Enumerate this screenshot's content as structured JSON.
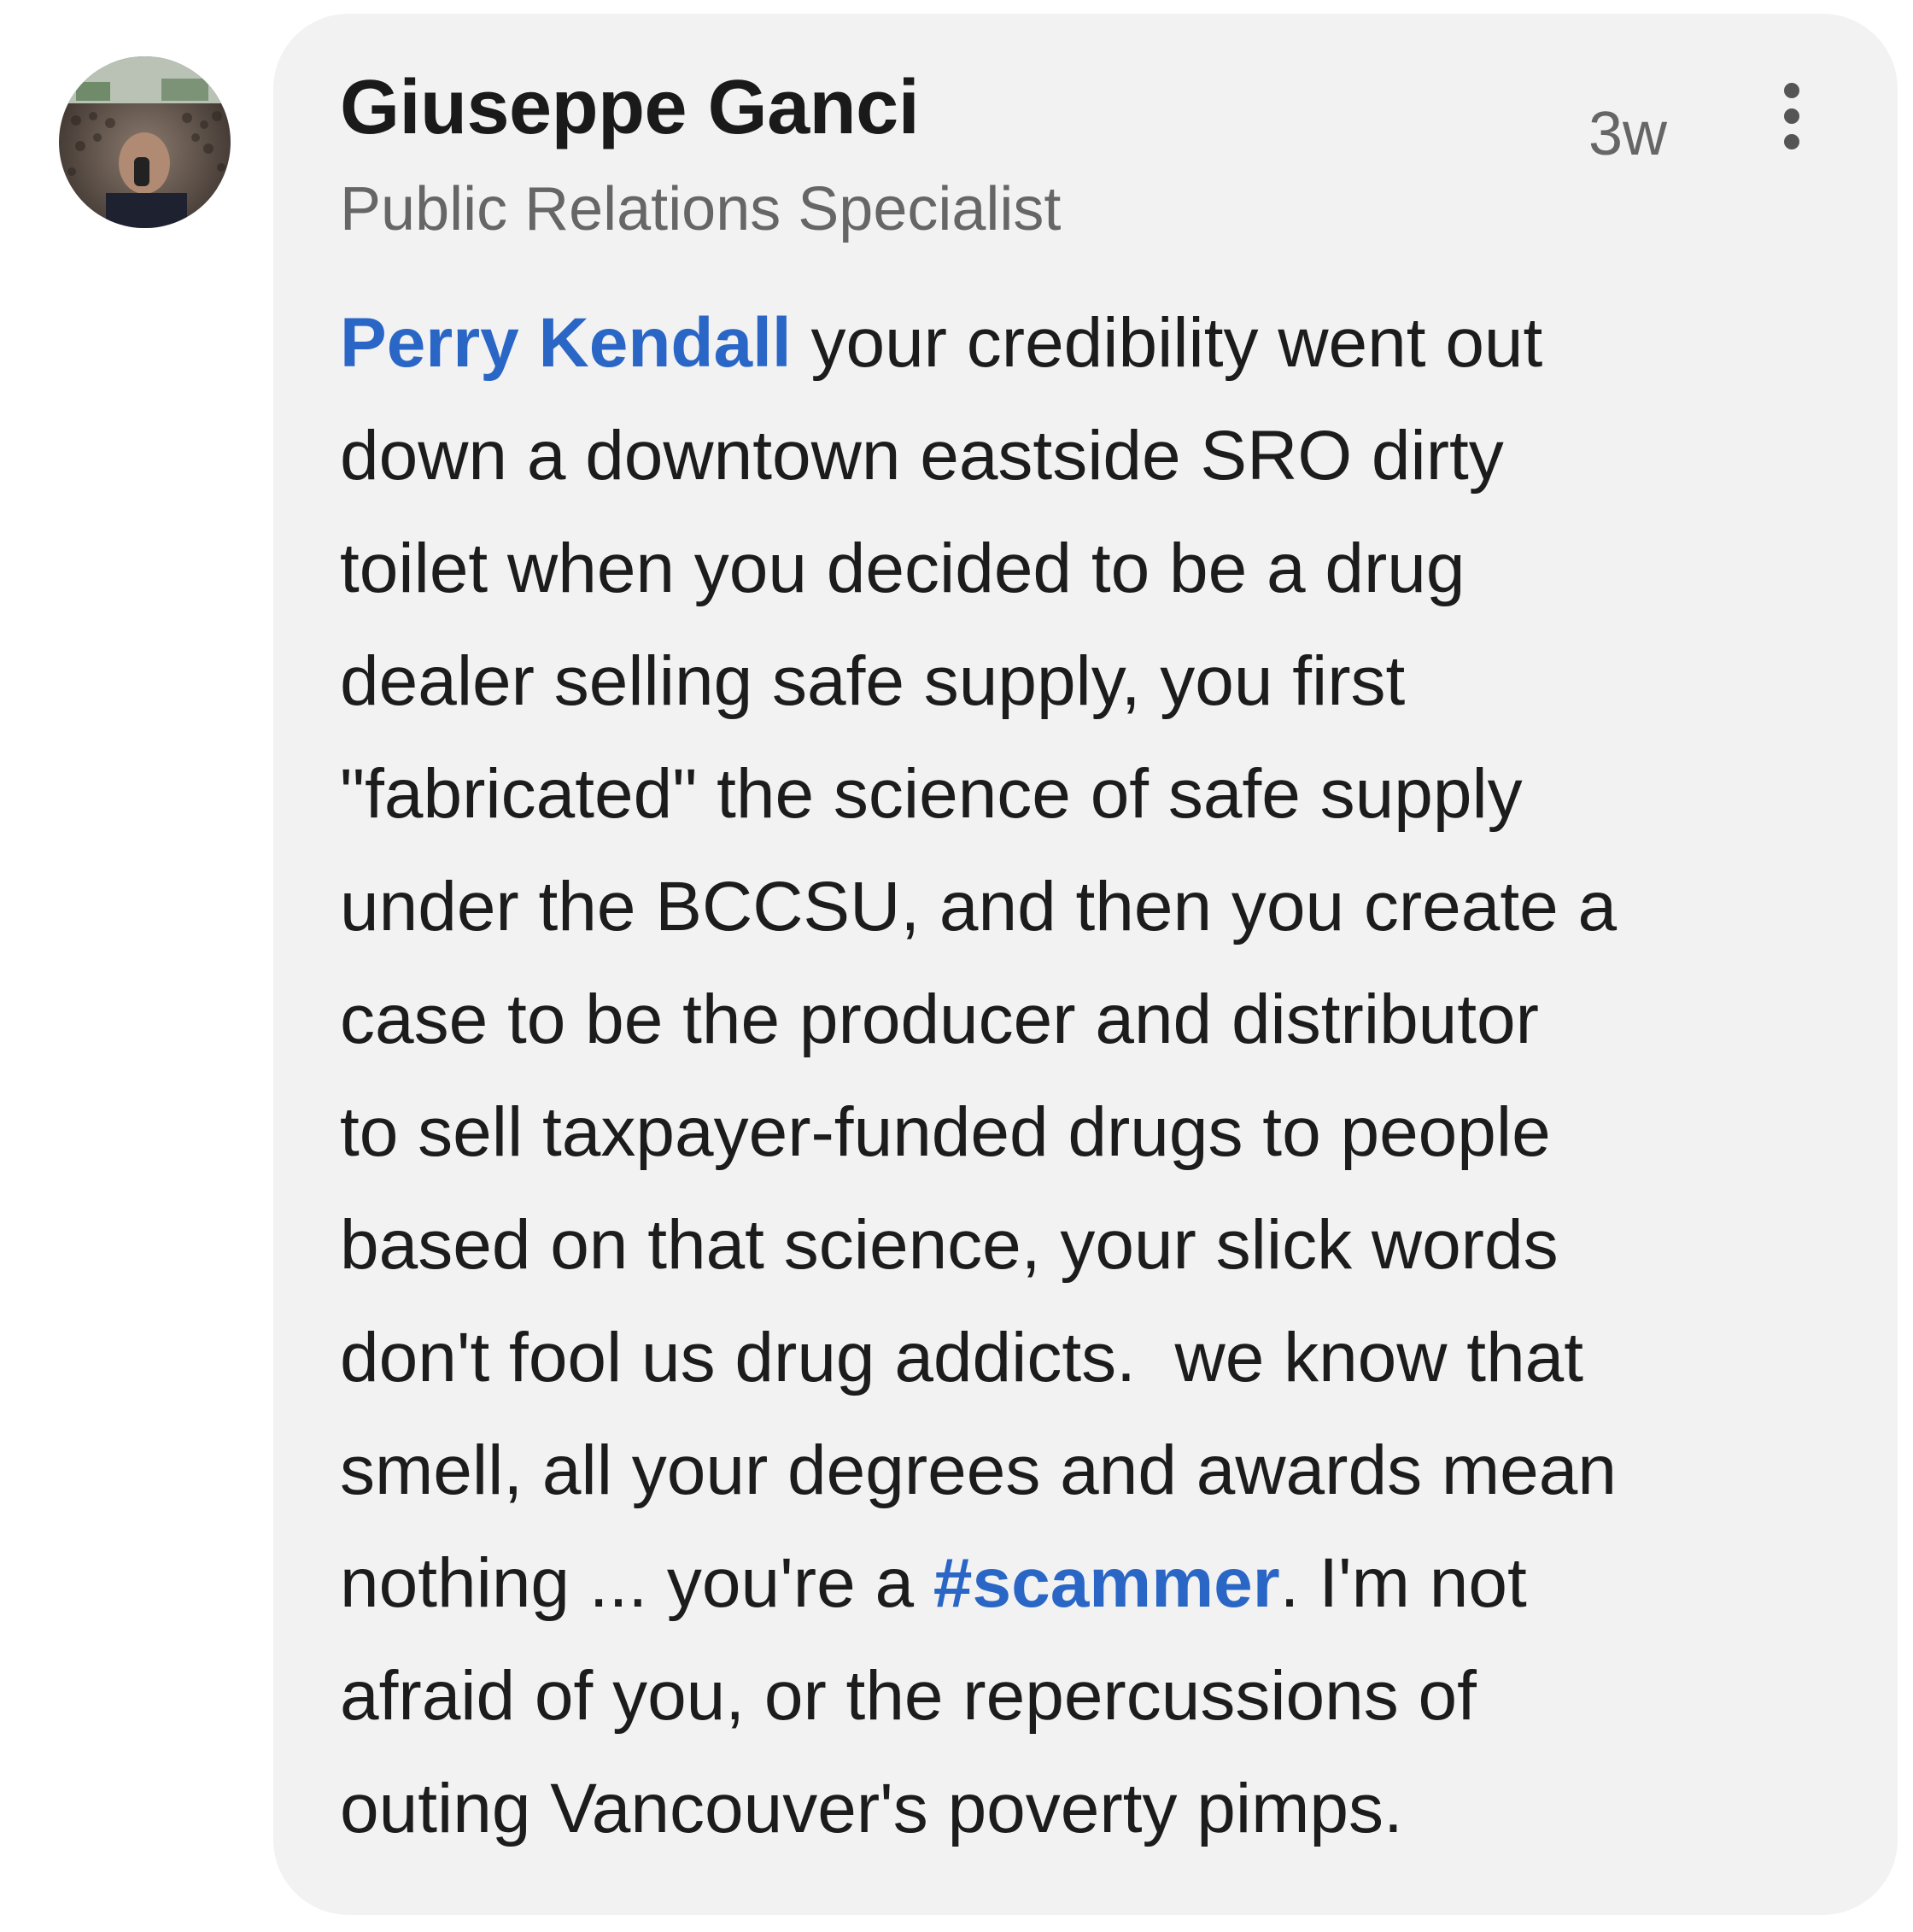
{
  "comment": {
    "author": {
      "name": "Giuseppe Ganci",
      "headline": "Public Relations Specialist"
    },
    "timestamp": "3w",
    "menu_icon": "more-vertical-icon",
    "accent_color": "#2a66c6",
    "body": {
      "mention": "Perry Kendall",
      "line1_rest": " your credibility went out",
      "line2": "down a downtown eastside SRO dirty",
      "line3": "toilet when you decided to be a drug",
      "line4": "dealer selling safe supply, you first",
      "line5": "\"fabricated\" the science of safe supply",
      "line6": "under the BCCSU, and then you create a",
      "line7": "case to be the producer and distributor",
      "line8": "to sell taxpayer-funded drugs to people",
      "line9": "based on that science, your slick words",
      "line10": "don't fool us drug addicts.  we know that",
      "line11": "smell, all your degrees and awards mean",
      "line12_before": "nothing ... you're a ",
      "hashtag": "#scammer",
      "line12_after": ". I'm not",
      "line13": "afraid of you, or the repercussions of",
      "line14": "outing Vancouver's poverty pimps."
    }
  }
}
